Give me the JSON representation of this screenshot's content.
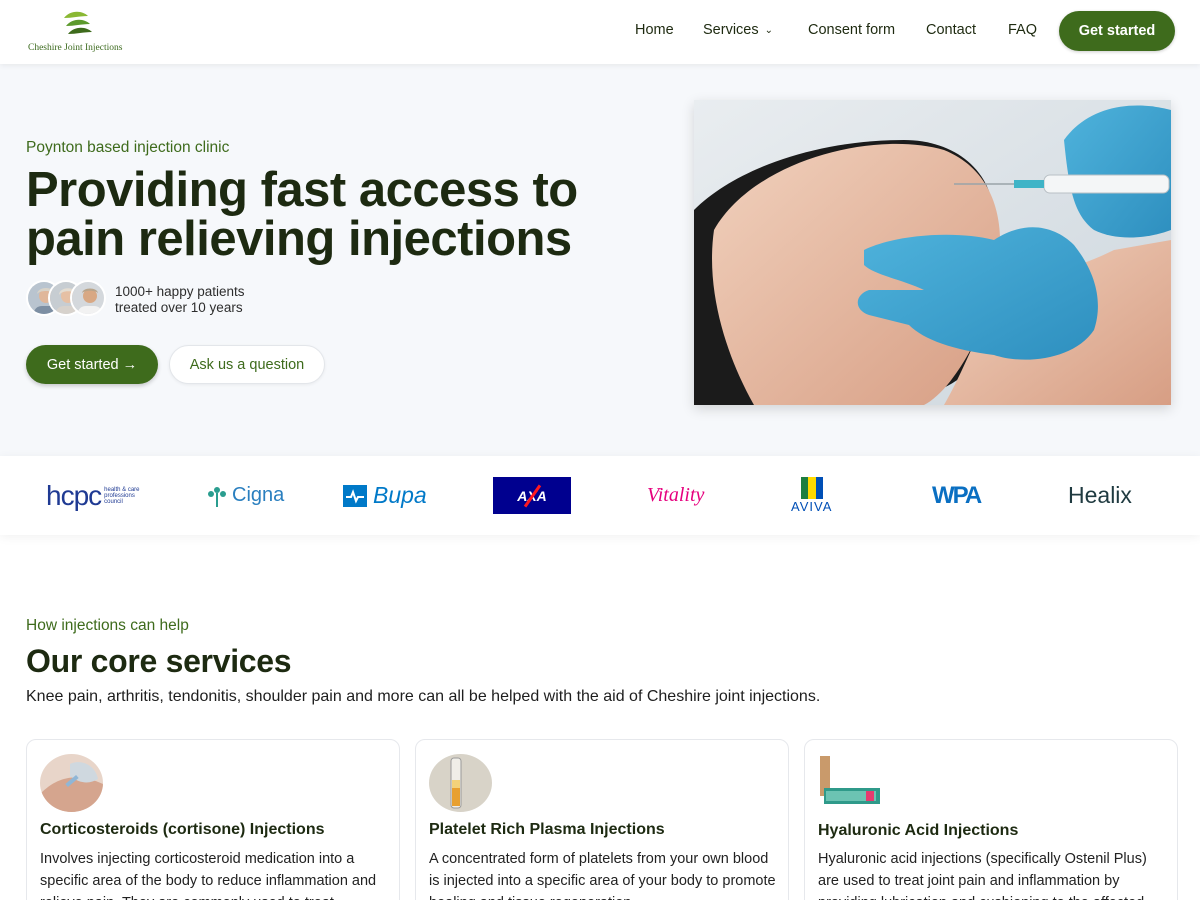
{
  "header": {
    "logo_text": "Cheshire Joint Injections",
    "nav": [
      "Home",
      "Services",
      "Consent form",
      "Contact",
      "FAQ"
    ],
    "cta": "Get started"
  },
  "hero": {
    "eyebrow": "Poynton based injection clinic",
    "title_line1": "Providing fast access to",
    "title_line2": "pain relieving injections",
    "happy_line1": "1000+ happy patients",
    "happy_line2": "treated over 10 years",
    "primary_button": "Get started →",
    "secondary_button": "Ask us a question"
  },
  "partners": [
    "hcpc",
    "Cigna",
    "Bupa",
    "AXA",
    "Vitality",
    "AVIVA",
    "WPA",
    "Healix"
  ],
  "services": {
    "eyebrow": "How injections can help",
    "title": "Our core services",
    "subtitle": "Knee pain, arthritis, tendonitis, shoulder pain and more can all be helped with the aid of Cheshire joint injections.",
    "cards": [
      {
        "title": "Corticosteroids (cortisone) Injections",
        "text": "Involves injecting corticosteroid medication into a specific area of the body to reduce inflammation and relieve pain. They are commonly used to treat"
      },
      {
        "title": "Platelet Rich Plasma Injections",
        "text": "A concentrated form of platelets from your own blood is injected into a specific area of your body to promote healing and tissue regeneration."
      },
      {
        "title": "Hyaluronic Acid Injections",
        "text": "Hyaluronic acid injections (specifically Ostenil Plus) are used to treat joint pain and inflammation by providing lubrication and cushioning to the affected"
      }
    ]
  },
  "colors": {
    "brand_green": "#3e6b1c",
    "dark_text": "#1d2a11",
    "hero_bg": "#f6f8fb"
  }
}
